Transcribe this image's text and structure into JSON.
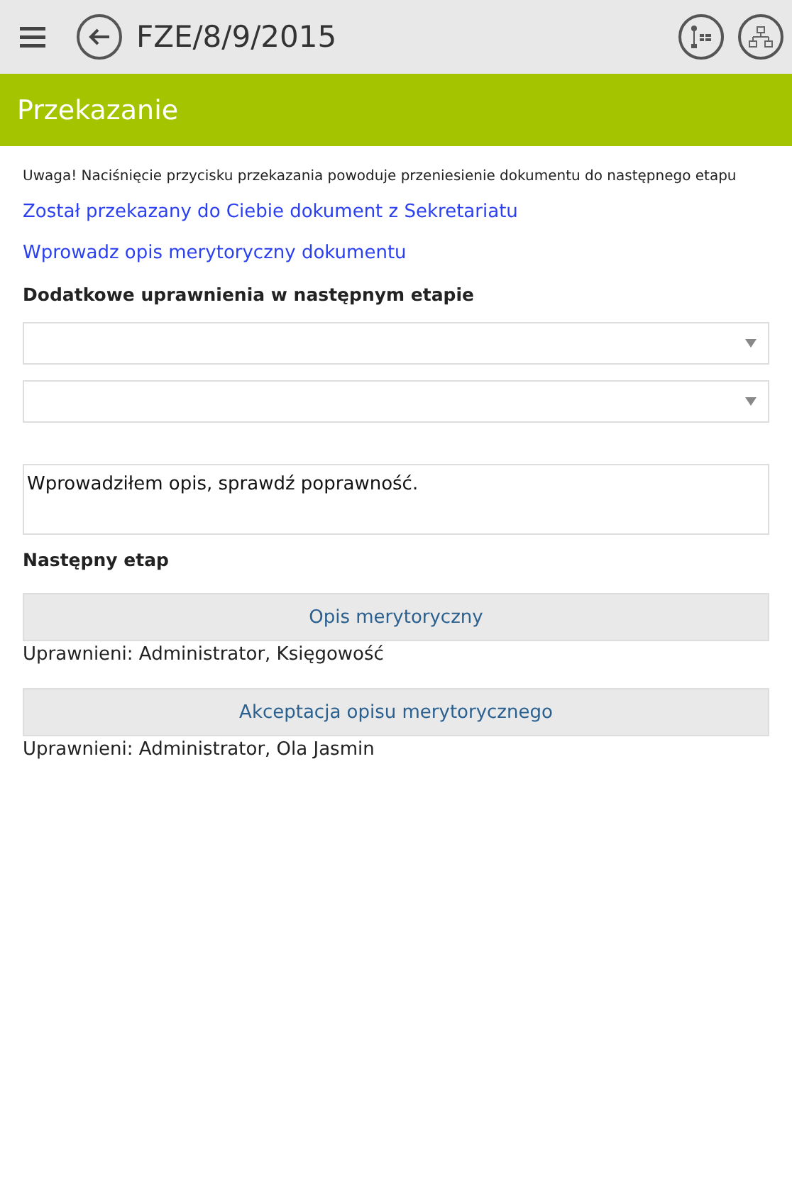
{
  "header": {
    "title": "FZE/8/9/2015"
  },
  "section": {
    "title": "Przekazanie"
  },
  "notice": "Uwaga! Naciśnięcie przycisku przekazania powoduje przeniesienie dokumentu do następnego etapu",
  "links": [
    "Został przekazany do Ciebie dokument z Sekretariatu",
    "Wprowadz opis merytoryczny dokumentu"
  ],
  "permissions": {
    "label": "Dodatkowe uprawnienia w następnym etapie"
  },
  "comment": {
    "value": "Wprowadziłem opis, sprawdź poprawność."
  },
  "next_stage": {
    "label": "Następny etap",
    "stages": [
      {
        "name": "Opis merytoryczny",
        "users": "Uprawnieni: Administrator, Księgowość"
      },
      {
        "name": "Akceptacja opisu merytorycznego",
        "users": "Uprawnieni: Administrator, Ola Jasmin"
      }
    ]
  }
}
